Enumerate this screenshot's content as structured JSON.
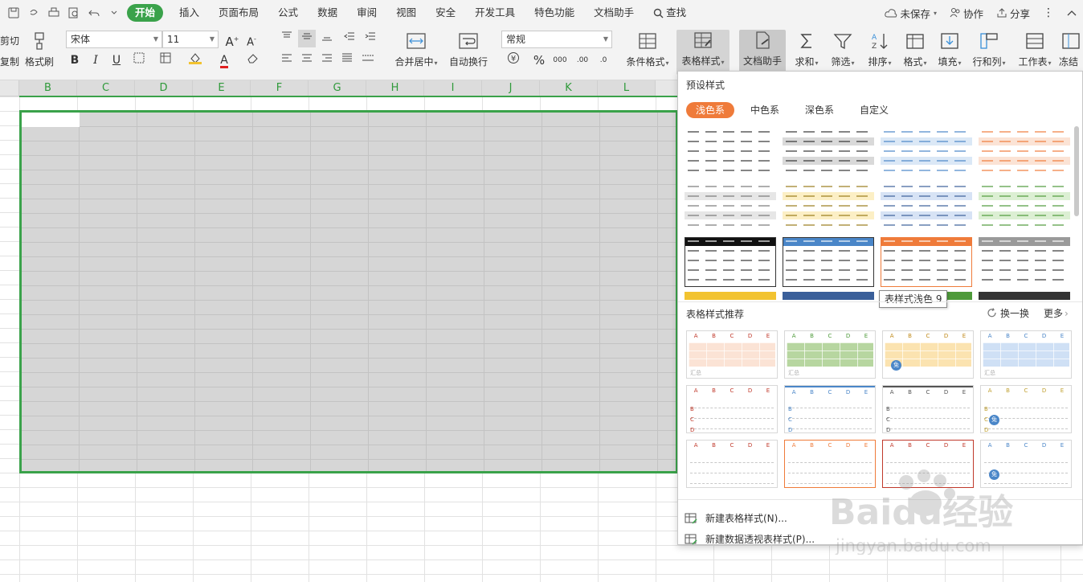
{
  "menubar": {
    "tabs": [
      "开始",
      "插入",
      "页面布局",
      "公式",
      "数据",
      "审阅",
      "视图",
      "安全",
      "开发工具",
      "特色功能",
      "文档助手"
    ],
    "search": "查找",
    "save_status": "未保存",
    "collab": "协作",
    "share": "分享"
  },
  "ribbon": {
    "cut": "剪切",
    "copy": "复制",
    "format_painter": "格式刷",
    "font_name": "宋体",
    "font_size": "11",
    "number_format": "常规",
    "merge_center": "合并居中",
    "wrap_text": "自动换行",
    "conditional_format": "条件格式",
    "table_style": "表格样式",
    "doc_assistant": "文档助手",
    "sum": "求和",
    "filter": "筛选",
    "sort": "排序",
    "format": "格式",
    "fill": "填充",
    "row_col": "行和列",
    "worksheet": "工作表",
    "freeze": "冻结"
  },
  "sheet": {
    "columns": [
      "B",
      "C",
      "D",
      "E",
      "F",
      "G",
      "H",
      "I",
      "J",
      "K",
      "L"
    ]
  },
  "panel": {
    "preset_title": "预设样式",
    "categories": [
      "浅色系",
      "中色系",
      "深色系",
      "自定义"
    ],
    "active_category": "浅色系",
    "tooltip": "表样式浅色 9",
    "recommend_title": "表格样式推荐",
    "refresh": "换一换",
    "more": "更多",
    "new_table_style": "新建表格样式(N)...",
    "new_pivot_style": "新建数据透视表样式(P)...",
    "rec_letters": [
      "A",
      "B",
      "C",
      "D",
      "E"
    ],
    "rec_summary": "汇总",
    "free_badge": "免",
    "colors": {
      "accent_green": "#3aa24a",
      "accent_orange": "#ef7b3a",
      "blue": "#4a86c8",
      "yellow": "#f2c330",
      "gray": "#9a9a9a",
      "red": "#c0392b"
    }
  },
  "watermark": {
    "brand": "Baidu经验",
    "url": "jingyan.baidu.com"
  }
}
